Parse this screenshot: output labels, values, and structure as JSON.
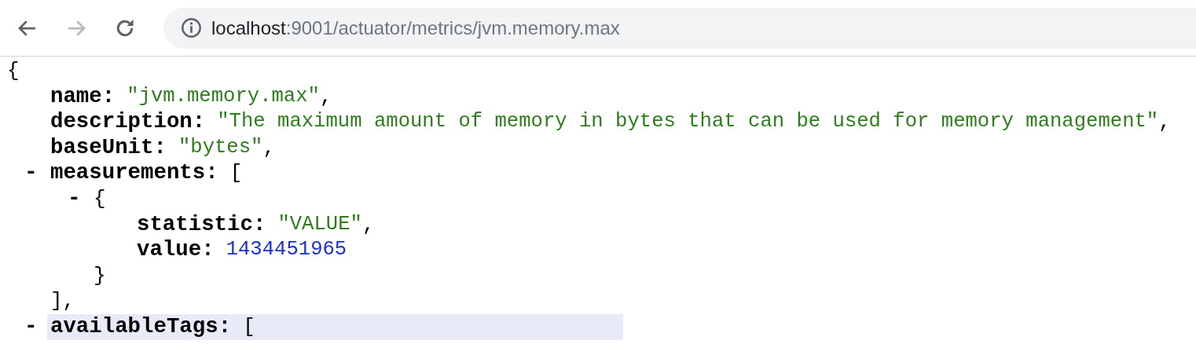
{
  "toolbar": {
    "nav_buttons": [
      {
        "kind": "back",
        "disabled": false
      },
      {
        "kind": "forward",
        "disabled": true
      },
      {
        "kind": "reload",
        "disabled": false
      }
    ],
    "address_bar": {
      "host": "localhost",
      "path": ":9001/actuator/metrics/jvm.memory.max"
    }
  },
  "json_view": {
    "root": {
      "kind": "container",
      "open": "{",
      "children": [
        {
          "kind": "string",
          "key": "name:",
          "value": "\"jvm.memory.max\"",
          "punct": ","
        },
        {
          "kind": "string",
          "key": "description:",
          "value": "\"The maximum amount of memory in bytes that can be used for memory management\"",
          "punct": ","
        },
        {
          "kind": "string",
          "key": "baseUnit:",
          "value": "\"bytes\"",
          "punct": ","
        },
        {
          "kind": "container",
          "key": "measurements:",
          "toggle": "-",
          "open": "[",
          "close": "],",
          "children": [
            {
              "kind": "container",
              "toggle": "-",
              "open": "{",
              "close": "}",
              "children": [
                {
                  "kind": "string",
                  "key": "statistic:",
                  "value": "\"VALUE\"",
                  "punct": ","
                },
                {
                  "kind": "number",
                  "key": "value:",
                  "value": "1434451965"
                }
              ]
            }
          ]
        },
        {
          "kind": "container",
          "key": "availableTags:",
          "toggle": "-",
          "open": "[",
          "highlighted": true
        }
      ]
    }
  }
}
